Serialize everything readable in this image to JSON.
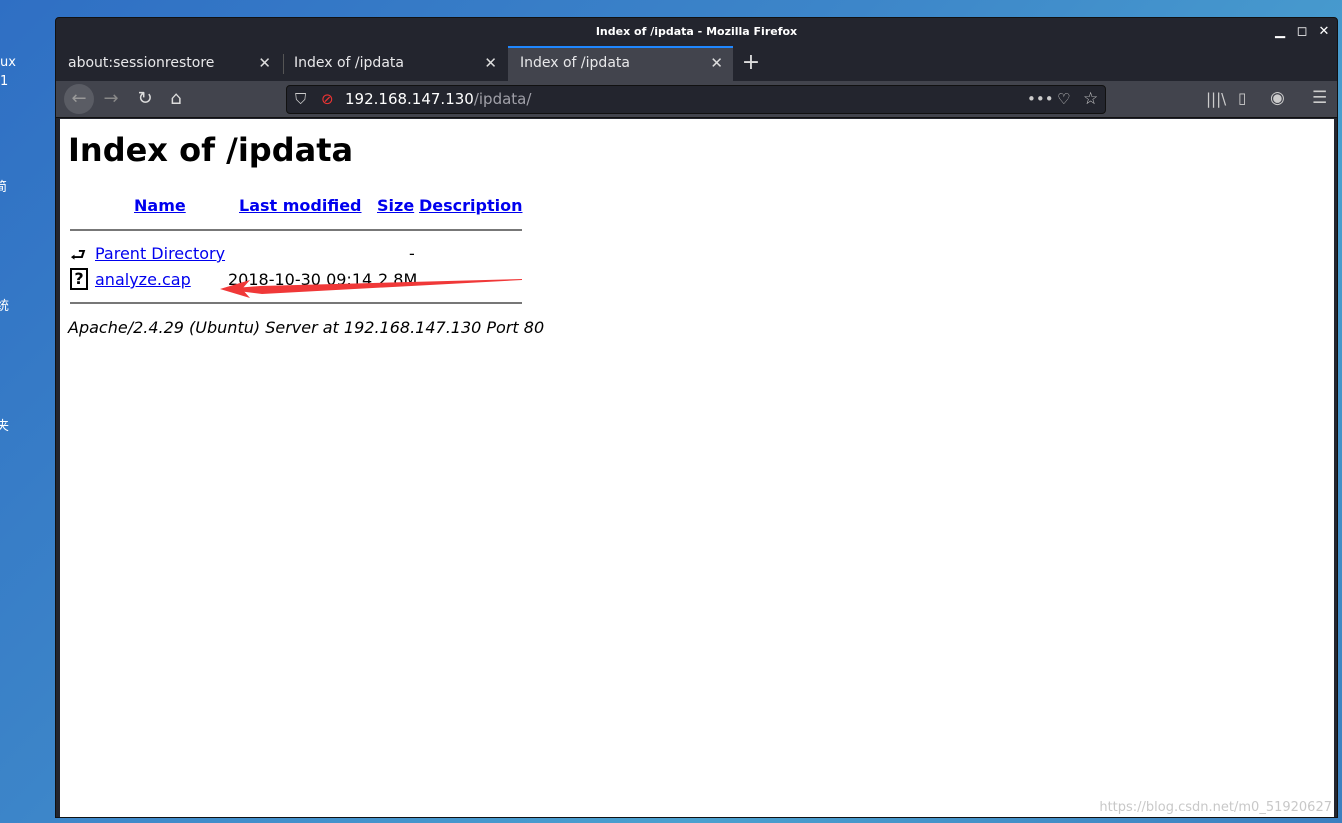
{
  "desktop": {
    "fragments": [
      "ux",
      "1",
      "简",
      "统",
      "夹"
    ]
  },
  "window": {
    "title": "Index of /ipdata - Mozilla Firefox"
  },
  "tabs": [
    {
      "label": "about:sessionrestore"
    },
    {
      "label": "Index of /ipdata"
    },
    {
      "label": "Index of /ipdata",
      "active": true
    }
  ],
  "urlbar": {
    "host": "192.168.147.130",
    "path": "/ipdata/"
  },
  "page": {
    "title": "Index of /ipdata",
    "headers": {
      "name": "Name",
      "modified": "Last modified",
      "size": "Size",
      "description": "Description"
    },
    "rows": [
      {
        "name": "Parent Directory",
        "modified": "",
        "size": "-",
        "icon": "back-arrow-icon"
      },
      {
        "name": "analyze.cap",
        "modified": "2018-10-30 09:14",
        "size": "2.8M",
        "icon": "unknown-file-icon"
      }
    ],
    "footer": "Apache/2.4.29 (Ubuntu) Server at 192.168.147.130 Port 80"
  },
  "annotation": {
    "arrow_color": "#f03838"
  },
  "watermark": "https://blog.csdn.net/m0_51920627"
}
